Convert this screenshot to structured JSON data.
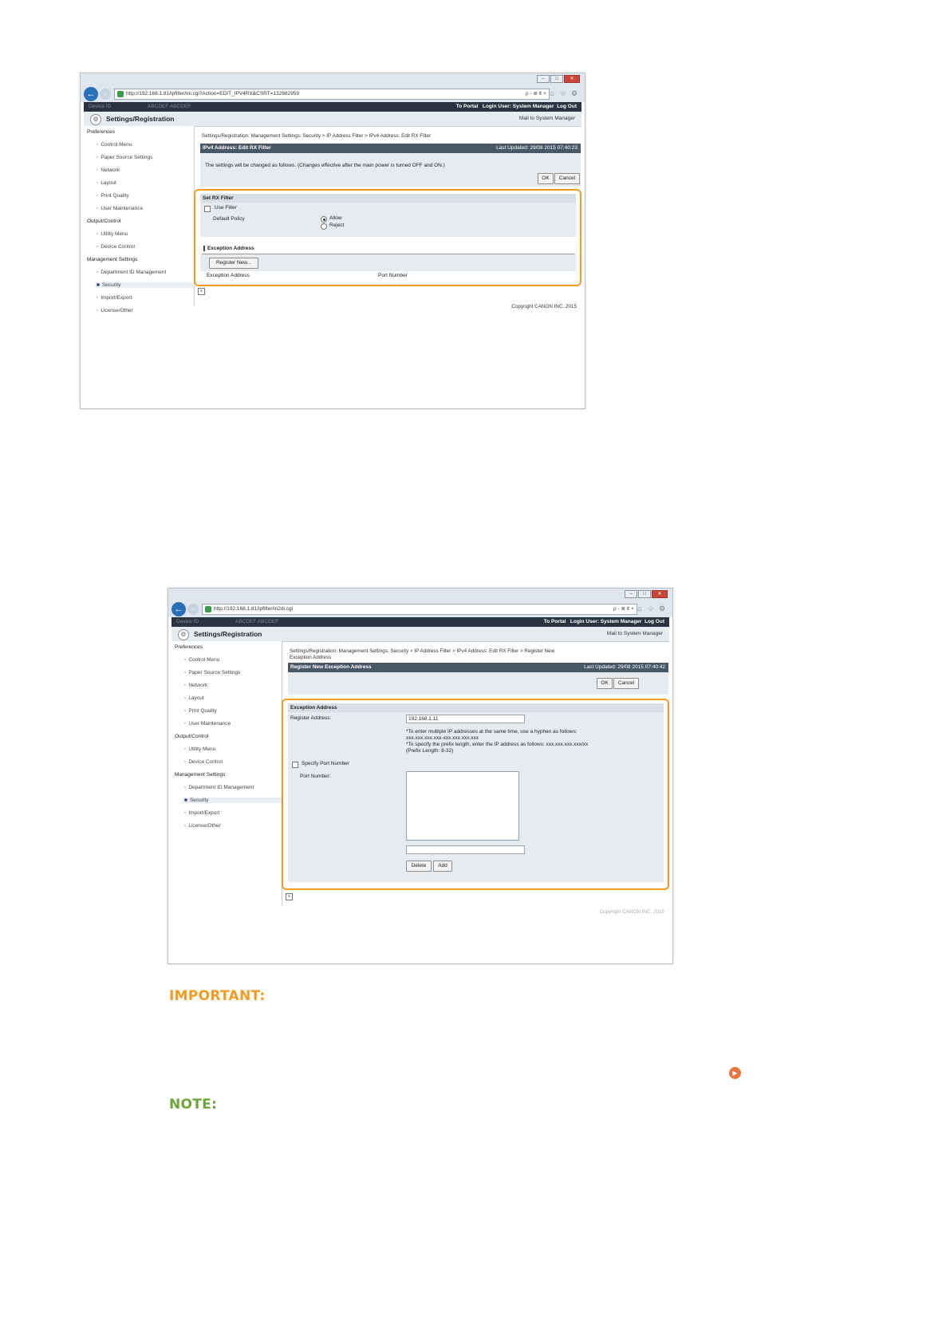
{
  "shot1": {
    "url": "http://192.168.1.81/ipfilter/ini.cgi?Action=EDIT_IPV4RX&CSRT=132882959",
    "address_tools": "ρ - ≣ ¢ ×",
    "topbar": {
      "to_portal": "To Portal",
      "login_user": "Login User: System Manager",
      "log_out": "Log Out",
      "blur1": "Device ID",
      "blur2": "ABCDEF ABCDEF"
    },
    "header": {
      "title": "Settings/Registration",
      "mail": "Mail to System Manager"
    },
    "sidebar": [
      {
        "type": "group",
        "label": "Preferences"
      },
      {
        "type": "item",
        "label": "Control Menu"
      },
      {
        "type": "item",
        "label": "Paper Source Settings"
      },
      {
        "type": "item",
        "label": "Network"
      },
      {
        "type": "item",
        "label": "Layout"
      },
      {
        "type": "item",
        "label": "Print Quality"
      },
      {
        "type": "item",
        "label": "User Maintenance"
      },
      {
        "type": "group",
        "label": "Output/Control"
      },
      {
        "type": "item",
        "label": "Utility Menu"
      },
      {
        "type": "item",
        "label": "Device Control"
      },
      {
        "type": "group",
        "label": "Management Settings"
      },
      {
        "type": "item",
        "label": "Department ID Management"
      },
      {
        "type": "item",
        "label": "Security",
        "selected": true
      },
      {
        "type": "item",
        "label": "Import/Export"
      },
      {
        "type": "item",
        "label": "License/Other"
      }
    ],
    "breadcrumb": "Settings/Registration: Management Settings: Security > IP Address Filter > IPv4 Address: Edit RX Filter",
    "panel_title": "IPv4 Address: Edit RX Filter",
    "last_updated": "Last Updated: 29/08 2015 07:40:23",
    "message": "The settings will be changed as follows. (Changes effective after the main power is turned OFF and ON.)",
    "ok": "OK",
    "cancel": "Cancel",
    "set_rx_filter": "Set RX Filter",
    "use_filter": "Use Filter",
    "default_policy": "Default Policy",
    "allow": "Allow",
    "reject": "Reject",
    "exception_address_heading": "Exception Address",
    "register_new": "Register New...",
    "col_exception": "Exception Address",
    "col_port": "Port Number",
    "copyright": "Copyright CANON INC. 2015"
  },
  "shot2": {
    "url": "http://192.168.1.81/ipfilter/in2di.cgi",
    "address_tools": "ρ - ≣ ¢ ×",
    "topbar": {
      "to_portal": "To Portal",
      "login_user": "Login User: System Manager",
      "log_out": "Log Out",
      "blur1": "Device ID",
      "blur2": "ABCDEF ABCDEF"
    },
    "header": {
      "title": "Settings/Registration",
      "mail": "Mail to System Manager"
    },
    "breadcrumb1": "Settings/Registration: Management Settings: Security > IP Address Filter > IPv4 Address: Edit RX Filter > Register New",
    "breadcrumb2": "Exception Address",
    "panel_title": "Register New Exception Address",
    "last_updated": "Last Updated: 29/08 2015 07:40:42",
    "ok": "OK",
    "cancel": "Cancel",
    "exception_address": "Exception Address",
    "register_address_label": "Register Address:",
    "register_address_value": "192.168.1.11",
    "note1": "*To enter multiple IP addresses at the same time, use a hyphen as follows:",
    "note2": "xxx.xxx.xxx.xxx-xxx.xxx.xxx.xxx",
    "note3": "*To specify the prefix length, enter the IP address as follows: xxx.xxx.xxx.xxx/xx",
    "note4": "(Prefix Length: 8-32)",
    "specify_port": "Specify Port Number",
    "port_number_label": "Port Number:",
    "delete": "Delete",
    "add": "Add",
    "copyright": "Copyright CANON INC. 2015"
  },
  "important_label": "IMPORTANT:",
  "note_label": "NOTE:",
  "colors": {
    "important": "#f29b22",
    "note": "#6ea43a",
    "highlight": "#f29b22",
    "nav": "#2c6fb9"
  }
}
